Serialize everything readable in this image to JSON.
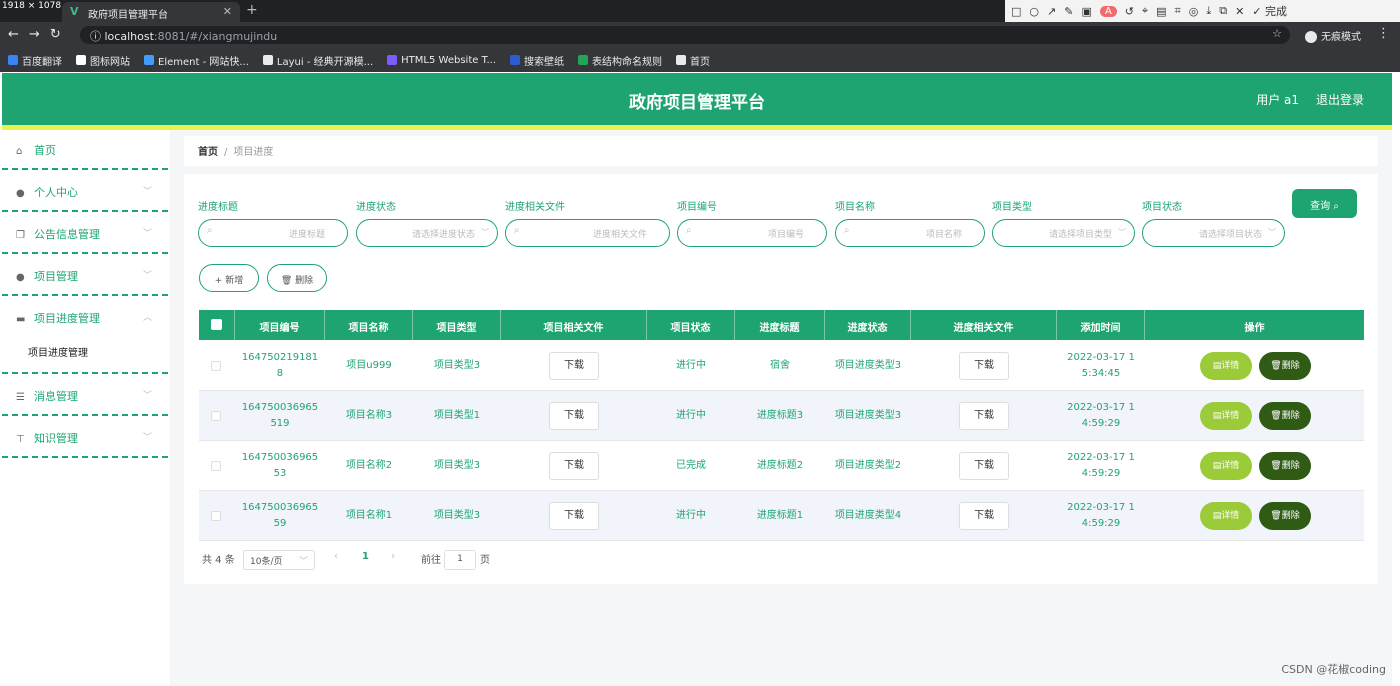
{
  "browser": {
    "dimension_label": "1918 × 1078",
    "tab_title": "政府项目管理平台",
    "url_host": "localhost",
    "url_path": ":8081/#/xiangmujindu",
    "incognito_label": "无痕模式",
    "capture_done_label": "完成",
    "bookmarks": [
      {
        "label": "百度翻译",
        "color": "#3b82f6"
      },
      {
        "label": "图标网站",
        "color": "#ffffff"
      },
      {
        "label": "Element - 网站快...",
        "color": "#409eff"
      },
      {
        "label": "Layui - 经典开源模...",
        "color": "#e8eaed"
      },
      {
        "label": "HTML5 Website T...",
        "color": "#7c5cff"
      },
      {
        "label": "搜索壁纸",
        "color": "#2d5bd3"
      },
      {
        "label": "表结构命名规则",
        "color": "#22a559"
      },
      {
        "label": "首页",
        "color": "#e8eaed"
      }
    ]
  },
  "header": {
    "title": "政府项目管理平台",
    "user": "用户 a1",
    "logout": "退出登录"
  },
  "sidebar": {
    "items": [
      {
        "label": "首页",
        "icon": "home-icon"
      },
      {
        "label": "个人中心",
        "icon": "user-icon"
      },
      {
        "label": "公告信息管理",
        "icon": "copy-icon"
      },
      {
        "label": "项目管理",
        "icon": "user-icon"
      },
      {
        "label": "项目进度管理",
        "icon": "briefcase-icon"
      },
      {
        "label": "消息管理",
        "icon": "list-icon"
      },
      {
        "label": "知识管理",
        "icon": "pin-icon"
      }
    ],
    "sub_item": "项目进度管理"
  },
  "breadcrumb": {
    "home": "首页",
    "separator": "/",
    "current": "项目进度"
  },
  "filters": [
    {
      "label": "进度标题",
      "placeholder": "进度标题",
      "type": "input"
    },
    {
      "label": "进度状态",
      "placeholder": "请选择进度状态",
      "type": "select"
    },
    {
      "label": "进度相关文件",
      "placeholder": "进度相关文件",
      "type": "input"
    },
    {
      "label": "项目编号",
      "placeholder": "项目编号",
      "type": "input"
    },
    {
      "label": "项目名称",
      "placeholder": "项目名称",
      "type": "input"
    },
    {
      "label": "项目类型",
      "placeholder": "请选择项目类型",
      "type": "select"
    },
    {
      "label": "项目状态",
      "placeholder": "请选择项目状态",
      "type": "select"
    }
  ],
  "query_button": "查询",
  "actions": {
    "add": "+ 新增",
    "delete": "删除"
  },
  "table": {
    "headers": [
      "项目编号",
      "项目名称",
      "项目类型",
      "项目相关文件",
      "项目状态",
      "进度标题",
      "进度状态",
      "进度相关文件",
      "添加时间",
      "操作"
    ],
    "download_label": "下载",
    "detail_label": "详情",
    "delete_label": "删除",
    "rows": [
      {
        "code_line1": "164750219181",
        "code_line2": "8",
        "name": "项目u999",
        "type": "项目类型3",
        "status": "进行中",
        "progress_title": "宿舍",
        "progress_status": "项目进度类型3",
        "time_line1": "2022-03-17 1",
        "time_line2": "5:34:45"
      },
      {
        "code_line1": "164750036965",
        "code_line2": "519",
        "name": "项目名称3",
        "type": "项目类型1",
        "status": "进行中",
        "progress_title": "进度标题3",
        "progress_status": "项目进度类型3",
        "time_line1": "2022-03-17 1",
        "time_line2": "4:59:29"
      },
      {
        "code_line1": "164750036965",
        "code_line2": "53",
        "name": "项目名称2",
        "type": "项目类型3",
        "status": "已完成",
        "progress_title": "进度标题2",
        "progress_status": "项目进度类型2",
        "time_line1": "2022-03-17 1",
        "time_line2": "4:59:29"
      },
      {
        "code_line1": "164750036965",
        "code_line2": "59",
        "name": "项目名称1",
        "type": "项目类型3",
        "status": "进行中",
        "progress_title": "进度标题1",
        "progress_status": "项目进度类型4",
        "time_line1": "2022-03-17 1",
        "time_line2": "4:59:29"
      }
    ]
  },
  "pagination": {
    "total": "共 4 条",
    "page_size": "10条/页",
    "current_page": "1",
    "goto_prefix": "前往",
    "goto_value": "1",
    "goto_suffix": "页"
  },
  "watermark": "CSDN @花椒coding",
  "colors": {
    "primary": "#1ea471",
    "accent_line": "#e8f44c",
    "detail_button": "#9ccb3a",
    "delete_button": "#2f5b15"
  }
}
